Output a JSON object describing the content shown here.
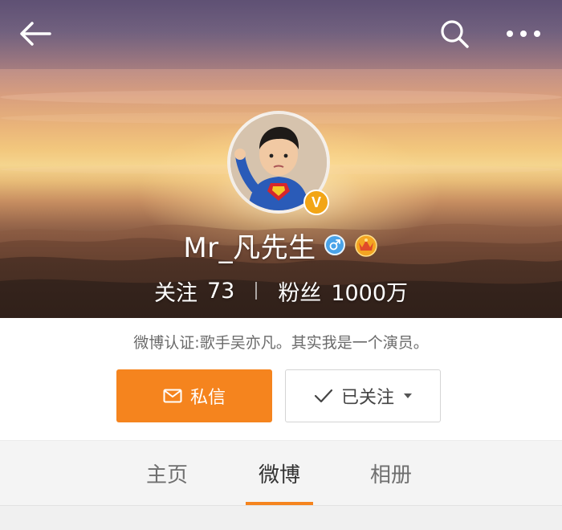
{
  "header": {
    "back_icon": "arrow-left-icon",
    "search_icon": "search-icon",
    "more_icon": "more-horizontal-icon"
  },
  "profile": {
    "username": "Mr_凡先生",
    "gender_icon": "male-icon",
    "vip_icon": "vip-crown-icon",
    "verified_mark": "V",
    "following_label": "关注",
    "following_count": "73",
    "followers_label": "粉丝",
    "followers_count": "1000万",
    "verification": "微博认证:歌手吴亦凡。其实我是一个演员。"
  },
  "actions": {
    "message_label": "私信",
    "following_label": "已关注"
  },
  "tabs": [
    {
      "label": "主页"
    },
    {
      "label": "微博",
      "active": true
    },
    {
      "label": "相册"
    }
  ],
  "colors": {
    "accent": "#f5841e",
    "verified": "#f2a516",
    "gender": "#4aa3e8"
  }
}
